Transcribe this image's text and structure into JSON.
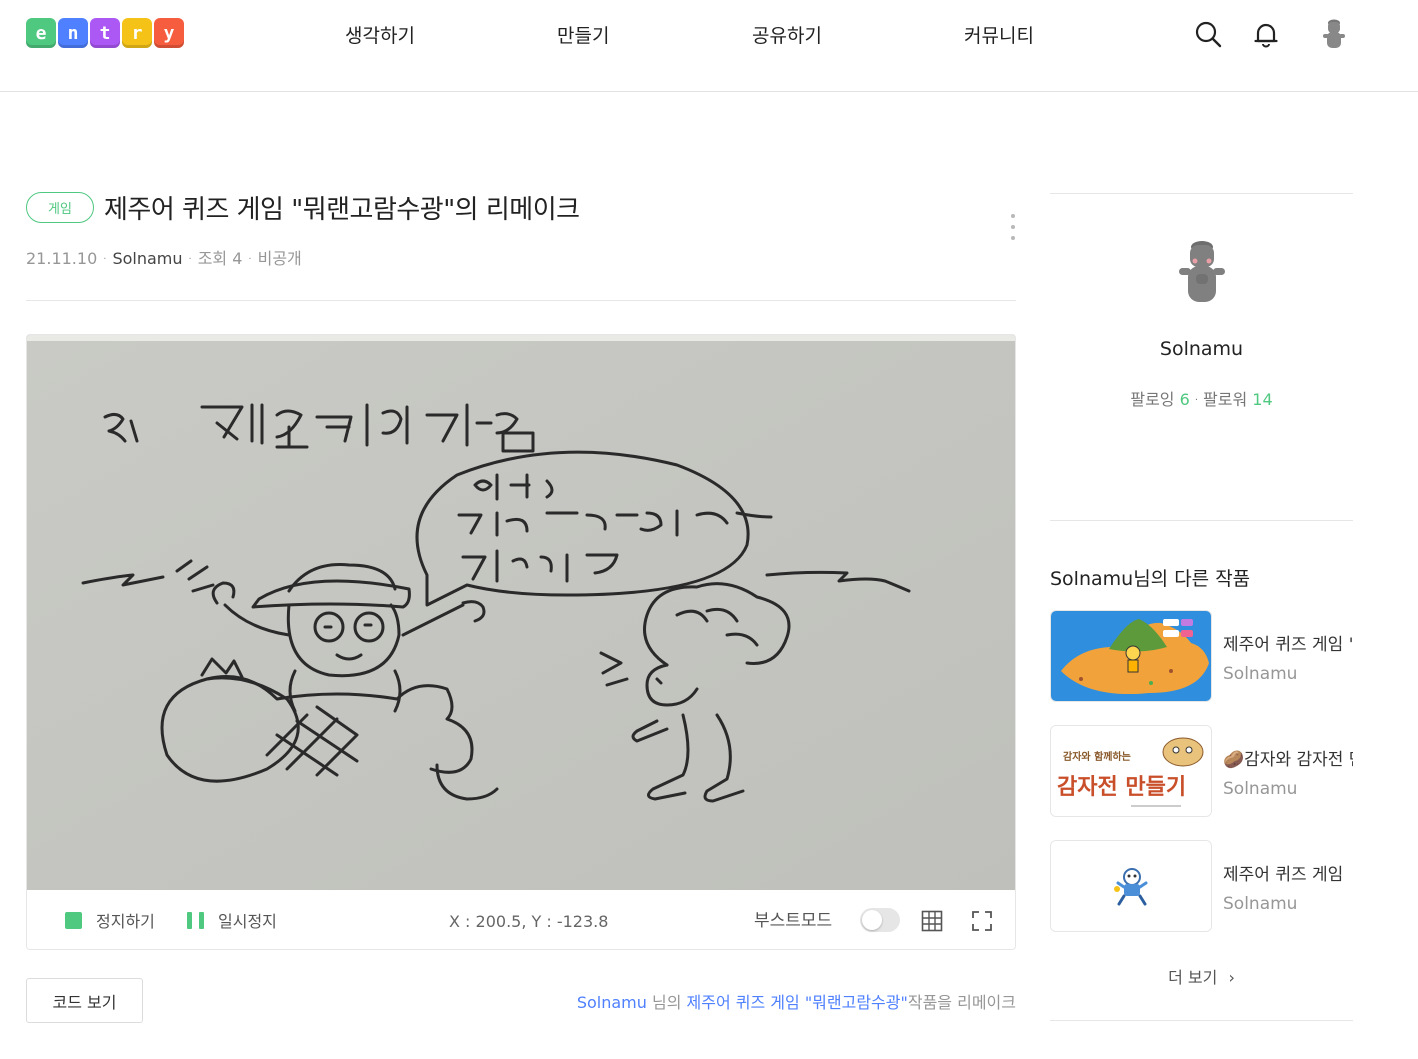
{
  "header": {
    "logo_letters": [
      "e",
      "n",
      "t",
      "r",
      "y"
    ],
    "logo_colors": [
      "#4fc880",
      "#4f80ff",
      "#ac58f5",
      "#f5c318",
      "#f55d3e"
    ],
    "nav": [
      "생각하기",
      "만들기",
      "공유하기",
      "커뮤니티"
    ]
  },
  "project": {
    "genre": "게임",
    "title": "제주어 퀴즈 게임 \"뭐랜고람수광\"의 리메이크",
    "date": "21.11.10",
    "author": "Solnamu",
    "views": "조회 4",
    "visibility": "비공개"
  },
  "player": {
    "stop_label": "정지하기",
    "pause_label": "일시정지",
    "coords": "X : 200.5, Y : -123.8",
    "boost_label": "부스트모드",
    "boost_on": false
  },
  "code_button": "코드 보기",
  "remake": {
    "author": "Solnamu",
    "mid": " 님의 ",
    "title": "제주어 퀴즈 게임 \"뭐랜고람수광\"",
    "suffix": "작품을 리메이크"
  },
  "sidebar": {
    "user_name": "Solnamu",
    "following_label": "팔로잉",
    "following_count": "6",
    "follower_label": "팔로워",
    "follower_count": "14",
    "other_works_title": "Solnamu님의 다른 작품",
    "works": [
      {
        "title": "제주어 퀴즈 게임 \"뭐랜고람수광\"",
        "author": "Solnamu"
      },
      {
        "title": "🥔감자와 감자전 만들기",
        "author": "Solnamu"
      },
      {
        "title": "제주어 퀴즈 게임",
        "author": "Solnamu"
      }
    ],
    "work2_thumb_small": "감자와 함께하는",
    "work2_thumb_big": "감자전 만들기",
    "more_label": "더 보기"
  },
  "colors": {
    "accent_green": "#4fc880",
    "link_blue": "#4f80ff",
    "stage_paper": "#c5c6c1"
  }
}
